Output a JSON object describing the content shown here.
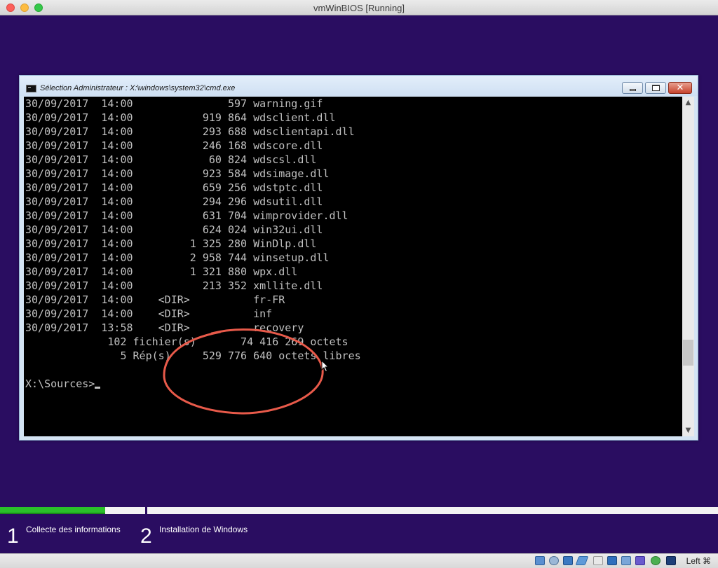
{
  "window": {
    "title": "vmWinBIOS [Running]"
  },
  "cmd": {
    "title": "Sélection Administrateur : X:\\windows\\system32\\cmd.exe",
    "lines": [
      "30/09/2017  14:00               597 warning.gif",
      "30/09/2017  14:00           919 864 wdsclient.dll",
      "30/09/2017  14:00           293 688 wdsclientapi.dll",
      "30/09/2017  14:00           246 168 wdscore.dll",
      "30/09/2017  14:00            60 824 wdscsl.dll",
      "30/09/2017  14:00           923 584 wdsimage.dll",
      "30/09/2017  14:00           659 256 wdstptc.dll",
      "30/09/2017  14:00           294 296 wdsutil.dll",
      "30/09/2017  14:00           631 704 wimprovider.dll",
      "30/09/2017  14:00           624 024 win32ui.dll",
      "30/09/2017  14:00         1 325 280 WinDlp.dll",
      "30/09/2017  14:00         2 958 744 winsetup.dll",
      "30/09/2017  14:00         1 321 880 wpx.dll",
      "30/09/2017  14:00           213 352 xmllite.dll",
      "30/09/2017  14:00    <DIR>          fr-FR",
      "30/09/2017  14:00    <DIR>          inf",
      "30/09/2017  13:58    <DIR>          recovery",
      "             102 fichier(s)       74 416 269 octets",
      "               5 Rép(s)     529 776 640 octets libres",
      "",
      "X:\\Sources>"
    ]
  },
  "setup": {
    "progress_fraction": 0.146,
    "steps": [
      {
        "number": "1",
        "label": "Collecte des informations"
      },
      {
        "number": "2",
        "label": "Installation de Windows"
      }
    ]
  },
  "status_bar": {
    "host_key": "Left ⌘",
    "icons": [
      "hard-disk-icon",
      "optical-drive-icon",
      "usb-icon",
      "shared-folder-icon",
      "display-icon",
      "network-icon",
      "recording-icon",
      "cpu-icon",
      "mouse-integration-icon",
      "arrow-down-icon"
    ]
  },
  "colors": {
    "vm_background": "#2a0d61",
    "progress_green": "#2ac02a",
    "annotation_red": "#e85a4a"
  }
}
